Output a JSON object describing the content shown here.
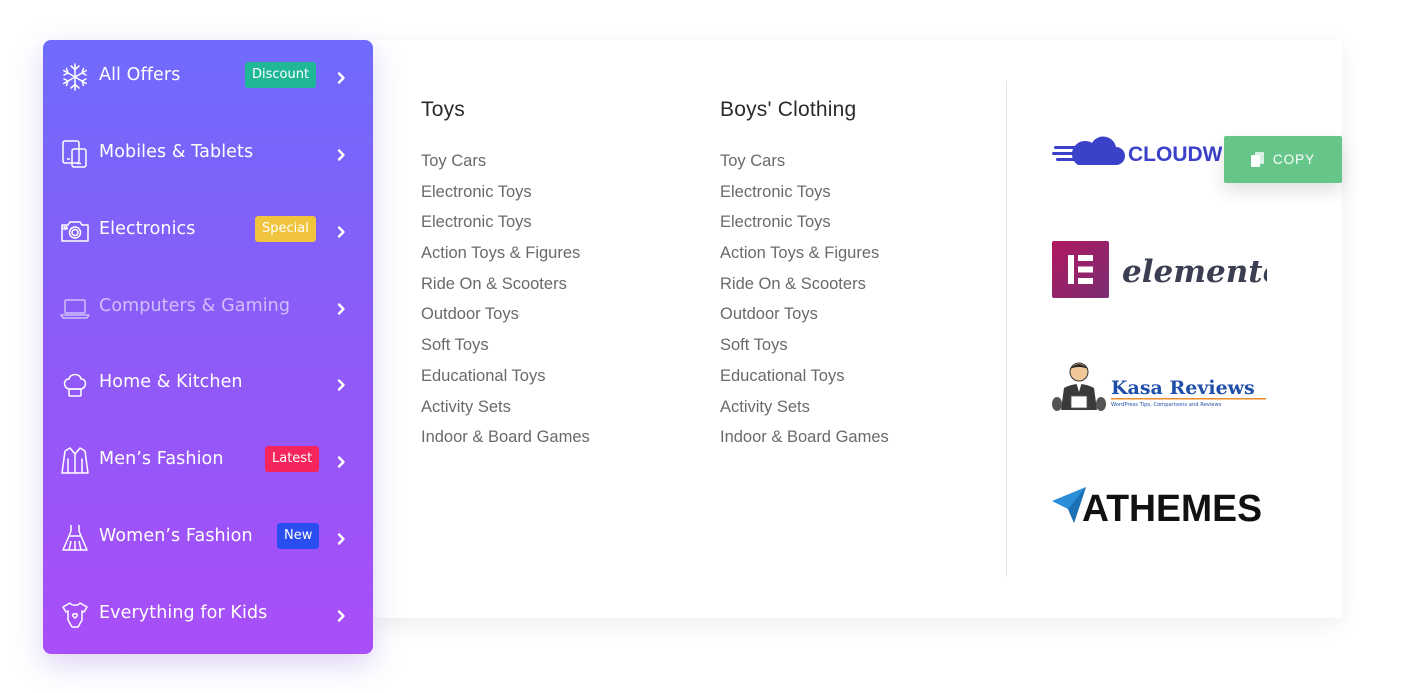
{
  "sidebar": {
    "items": [
      {
        "label": "All Offers",
        "icon": "snowflake-icon",
        "badge": "Discount",
        "badge_color": "#1fb796"
      },
      {
        "label": "Mobiles & Tablets",
        "icon": "devices-icon",
        "badge": null,
        "badge_color": null
      },
      {
        "label": "Electronics",
        "icon": "camera-icon",
        "badge": "Special",
        "badge_color": "#f0c43c"
      },
      {
        "label": "Computers & Gaming",
        "icon": "laptop-icon",
        "badge": null,
        "badge_color": null
      },
      {
        "label": "Home & Kitchen",
        "icon": "chef-hat-icon",
        "badge": null,
        "badge_color": null
      },
      {
        "label": "Men’s Fashion",
        "icon": "jacket-icon",
        "badge": "Latest",
        "badge_color": "#f5245c"
      },
      {
        "label": "Women’s Fashion",
        "icon": "dress-icon",
        "badge": "New",
        "badge_color": "#2b4ef0"
      },
      {
        "label": "Everything for Kids",
        "icon": "baby-onesie-icon",
        "badge": null,
        "badge_color": null
      }
    ]
  },
  "mega_menu": {
    "columns": [
      {
        "title": "Toys",
        "links": [
          "Toy Cars",
          "Electronic Toys",
          "Electronic Toys",
          "Action Toys & Figures",
          "Ride On & Scooters",
          "Outdoor Toys",
          "Soft Toys",
          "Educational Toys",
          "Activity Sets",
          "Indoor & Board Games"
        ]
      },
      {
        "title": "Boys' Clothing",
        "links": [
          "Toy Cars",
          "Electronic Toys",
          "Electronic Toys",
          "Action Toys & Figures",
          "Ride On & Scooters",
          "Outdoor Toys",
          "Soft Toys",
          "Educational Toys",
          "Activity Sets",
          "Indoor & Board Games"
        ]
      }
    ],
    "logos": {
      "cloudways": "CLOUDWA",
      "elementor": "elementor",
      "kasa": "Kasa Reviews",
      "kasa_tagline": "WordPress Tips, Comparisons and Reviews",
      "athemes": "ATHEMES"
    }
  },
  "copy_button": {
    "label": "COPY",
    "icon": "copy-icon"
  },
  "colors": {
    "accent_top": "#6f6bfd",
    "accent_bottom": "#a94ef8",
    "copy_green": "#66c68a"
  }
}
